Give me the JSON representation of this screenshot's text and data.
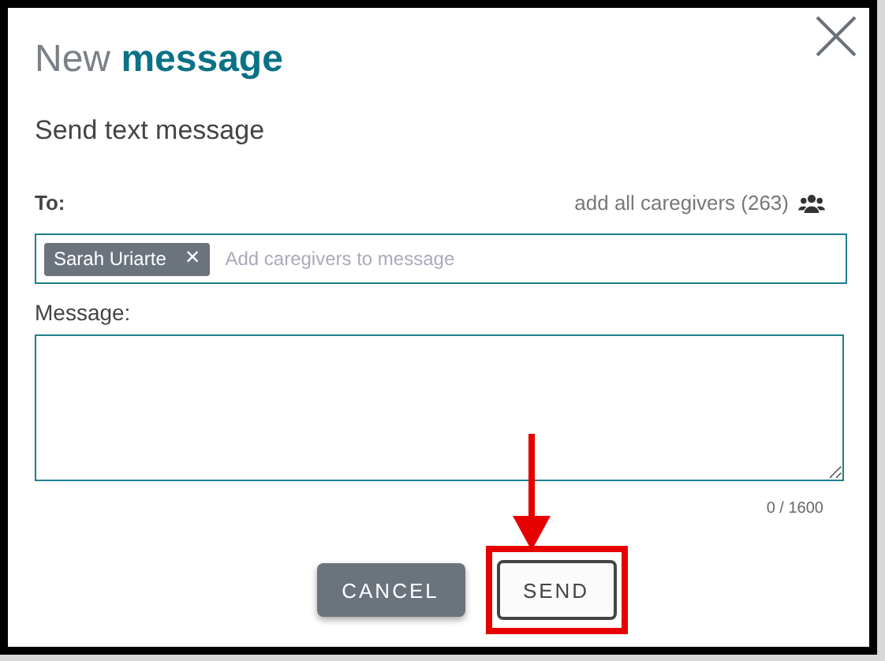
{
  "dialog": {
    "title_light": "New",
    "title_bold": "message",
    "subtitle": "Send text message"
  },
  "to": {
    "label": "To:",
    "add_all": "add all caregivers (263)",
    "recipients": [
      {
        "name": "Sarah Uriarte",
        "remove": "×"
      }
    ],
    "placeholder": "Add caregivers to message"
  },
  "message": {
    "label": "Message:",
    "counter": "0 / 1600"
  },
  "buttons": [
    {
      "label": "CANCEL",
      "kind": "secondary"
    },
    {
      "label": "SEND",
      "kind": "outline",
      "highlighted": true
    }
  ]
}
